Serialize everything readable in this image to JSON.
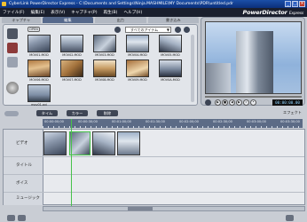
{
  "window": {
    "title": "CyberLink PowerDirector Express - C:\\Documents and Settings\\Ninja.MASHMILE\\MY Documents\\PDR\\untitled.pdr"
  },
  "brand": {
    "name": "PowerDirector",
    "suffix": "Express"
  },
  "menu": [
    {
      "label": "ファイル(F)"
    },
    {
      "label": "編集(E)"
    },
    {
      "label": "表示(V)"
    },
    {
      "label": "キャプチャ(P)"
    },
    {
      "label": "再生(B)"
    },
    {
      "label": "ヘルプ(H)"
    }
  ],
  "tabs": [
    {
      "label": "キャプチャ"
    },
    {
      "label": "編集"
    },
    {
      "label": "出力"
    },
    {
      "label": "書き込み"
    }
  ],
  "library": {
    "open_label": "OPEN",
    "filter": "すべてのアイテム",
    "clips": [
      {
        "label": "MOV01.MOD"
      },
      {
        "label": "MOV02.MOD"
      },
      {
        "label": "MOV03.MOD"
      },
      {
        "label": "MOV04.MOD"
      },
      {
        "label": "MOV05.MOD"
      },
      {
        "label": "MOV06.MOD"
      },
      {
        "label": "MOV07.MOD"
      },
      {
        "label": "MOV08.MOD"
      },
      {
        "label": "MOV09.MOD"
      },
      {
        "label": "MOV0A.MOD"
      },
      {
        "label": "mov01.avi"
      }
    ]
  },
  "preview": {
    "timecode": "00:00:00.00"
  },
  "timeline": {
    "tools": [
      {
        "label": "タイム"
      },
      {
        "label": "カラー"
      },
      {
        "label": "削除"
      }
    ],
    "right_label": "エフェクト",
    "ruler": [
      "00:00:00;00",
      "00:00:30;00",
      "00:01:00;00",
      "00:01:30;00",
      "00:02:00;00",
      "00:02:30;00",
      "00:03:00;00",
      "00:03:30;00"
    ],
    "tracks": [
      {
        "label": "ビデオ"
      },
      {
        "label": "タイトル"
      },
      {
        "label": "ボイス"
      },
      {
        "label": "ミュージック"
      }
    ]
  }
}
